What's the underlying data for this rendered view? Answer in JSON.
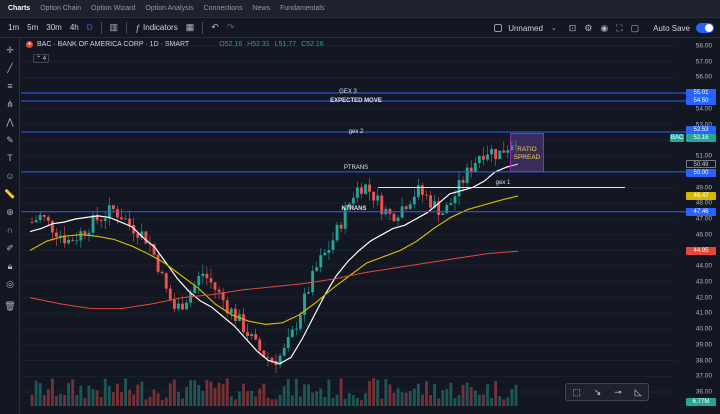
{
  "nav": {
    "tabs": [
      "Charts",
      "Option Chain",
      "Option Wizard",
      "Option Analysis",
      "Connections",
      "News",
      "Fundamentals"
    ]
  },
  "toolbar": {
    "intervals": [
      "1m",
      "5m",
      "30m",
      "4h",
      "D"
    ],
    "indicators_label": "Indicators",
    "layout_name": "Unnamed",
    "autosave_label": "Auto Save"
  },
  "legend": {
    "symbol": "BAC · BANK OF AMERICA CORP · 1D · SMART",
    "badge_count": "4",
    "open_label": "O",
    "open": "52.16",
    "high_label": "H",
    "high": "52.31",
    "low_label": "L",
    "low": "51.77",
    "close_label": "C",
    "close": "52.16"
  },
  "price_axis": {
    "ticks": [
      "58.00",
      "57.00",
      "56.00",
      "55.00",
      "54.00",
      "53.00",
      "52.00",
      "51.00",
      "50.00",
      "49.00",
      "48.00",
      "47.00",
      "46.00",
      "45.00",
      "44.00",
      "43.00",
      "42.00",
      "41.00",
      "40.00",
      "39.00",
      "38.00",
      "37.00",
      "36.00"
    ],
    "badges": [
      {
        "text": "55.01",
        "color": "#2962ff"
      },
      {
        "text": "54.50",
        "color": "#2962ff"
      },
      {
        "text": "52.53",
        "color": "#2962ff"
      },
      {
        "text": "52.16",
        "color": "#26a69a"
      },
      {
        "text": "50.49",
        "color": "#131722"
      },
      {
        "text": "50.00",
        "color": "#2962ff"
      },
      {
        "text": "48.47",
        "color": "#d4b800"
      },
      {
        "text": "47.46",
        "color": "#2962ff"
      },
      {
        "text": "44.95",
        "color": "#e5473c"
      },
      {
        "text": "6.77M",
        "color": "#26a69a"
      }
    ],
    "bac_tag": "BAC"
  },
  "levels": {
    "gex3": "GEX 3",
    "expected_move": "EXPECTED MOVE",
    "gex2": "gex 2",
    "ptrans": "PTRANS",
    "gex1": "gex 1",
    "ntrans": "NTRANS"
  },
  "ratio_box": {
    "line1": "RATIO",
    "line2": "SPREAD"
  },
  "colors": {
    "background": "#131722",
    "up": "#26a69a",
    "down": "#ef5350",
    "level_line": "#2962ff",
    "sma_fast": "#ffffff",
    "sma_mid": "#d4b800",
    "sma_slow": "#e5473c"
  },
  "chart_data": {
    "type": "line",
    "title": "BAC · BANK OF AMERICA CORP · 1D · SMART",
    "ylim": [
      35.5,
      58.5
    ],
    "ohlc_last": {
      "open": 52.16,
      "high": 52.31,
      "low": 51.77,
      "close": 52.16
    },
    "horizontal_levels": [
      {
        "name": "GEX 3",
        "value": 55.01
      },
      {
        "name": "EXPECTED MOVE",
        "value": 54.5
      },
      {
        "name": "gex 2",
        "value": 52.53
      },
      {
        "name": "PTRANS",
        "value": 50.0
      },
      {
        "name": "gex 1",
        "value": 49.0
      },
      {
        "name": "NTRANS",
        "value": 47.46
      }
    ],
    "series": [
      {
        "values": [
          46.8,
          47.2,
          46.6,
          46.1,
          45.6,
          45.9,
          46.4,
          46.9,
          47.2,
          47.6,
          47.2,
          46.6,
          46.2,
          45.6,
          44.2,
          42.4,
          41.2,
          41.8,
          42.6,
          43.6,
          42.9,
          42.1,
          41.3,
          40.6,
          39.8,
          38.9,
          38.3,
          38.0,
          38.4,
          39.6,
          41.2,
          42.8,
          44.2,
          45.0,
          46.2,
          47.5,
          48.8,
          49.2,
          48.6,
          47.8,
          47.2,
          47.6,
          48.2,
          48.8,
          48.4,
          47.8,
          47.4,
          48.3,
          49.4,
          50.3,
          51.2,
          51.4,
          51.1,
          51.6,
          52.16
        ]
      },
      {
        "values": [
          46.2,
          46.4,
          46.7,
          46.8,
          47.0,
          47.1,
          47.2,
          47.1,
          46.8,
          46.5,
          45.8,
          45.2,
          44.2,
          43.2,
          42.4,
          41.8,
          41.4,
          40.8,
          40.2,
          39.4,
          38.6,
          38.0,
          37.8,
          38.2,
          39.4,
          40.8,
          42.2,
          43.4,
          44.3,
          45.0,
          45.6,
          46.0,
          46.4,
          46.6,
          47.0,
          47.4,
          48.0,
          48.6,
          48.8,
          49.0,
          49.4,
          50.0,
          50.3,
          50.49
        ]
      },
      {
        "values": [
          45.0,
          45.6,
          45.9,
          46.0,
          45.9,
          45.7,
          45.3,
          44.8,
          44.2,
          43.4,
          42.6,
          41.6,
          40.9,
          40.5,
          40.3,
          40.4,
          40.9,
          41.7,
          42.6,
          43.4,
          44.2,
          44.6,
          45.0,
          45.6,
          46.4,
          47.1,
          47.6,
          47.9,
          48.2,
          48.47
        ]
      },
      {
        "values": [
          42.0,
          41.6,
          41.3,
          41.3,
          41.6,
          42.0,
          42.2,
          42.5,
          42.7,
          42.9,
          43.2,
          43.6,
          43.9,
          44.2,
          44.5,
          44.8,
          44.95
        ]
      }
    ],
    "volume_last": "6.77M"
  }
}
